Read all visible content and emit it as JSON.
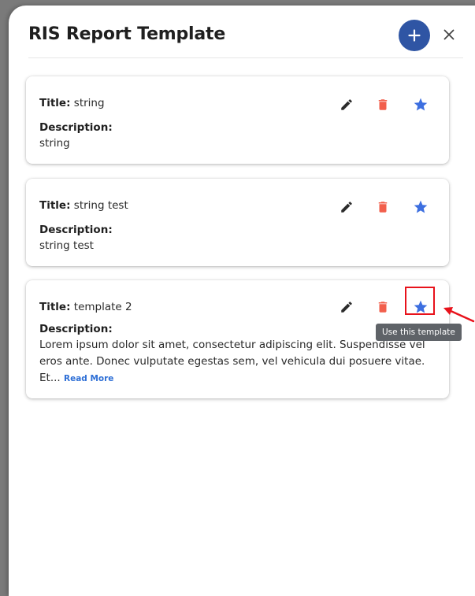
{
  "dialog": {
    "title": "RIS Report Template",
    "add_icon": "plus-icon",
    "close_icon": "close-icon"
  },
  "templates": [
    {
      "title_label": "Title:",
      "title_value": "string",
      "description_label": "Description:",
      "description_text": "string"
    },
    {
      "title_label": "Title:",
      "title_value": "string test",
      "description_label": "Description:",
      "description_text": "string test"
    },
    {
      "title_label": "Title:",
      "title_value": "template 2",
      "description_label": "Description:",
      "description_text": "Lorem ipsum dolor sit amet, consectetur adipiscing elit. Suspendisse vel eros ante. Donec vulputate egestas sem, vel vehicula dui posuere vitae. Et...",
      "read_more": "Read More"
    }
  ],
  "actions": {
    "edit_icon": "pencil-icon",
    "delete_icon": "trash-icon",
    "use_icon": "star-icon"
  },
  "tooltip": "Use this template",
  "colors": {
    "accent": "#2f55a4",
    "star": "#3d6fe0",
    "delete": "#f25f4c",
    "edit": "#2b2b2b",
    "annotation": "#e8121b"
  }
}
